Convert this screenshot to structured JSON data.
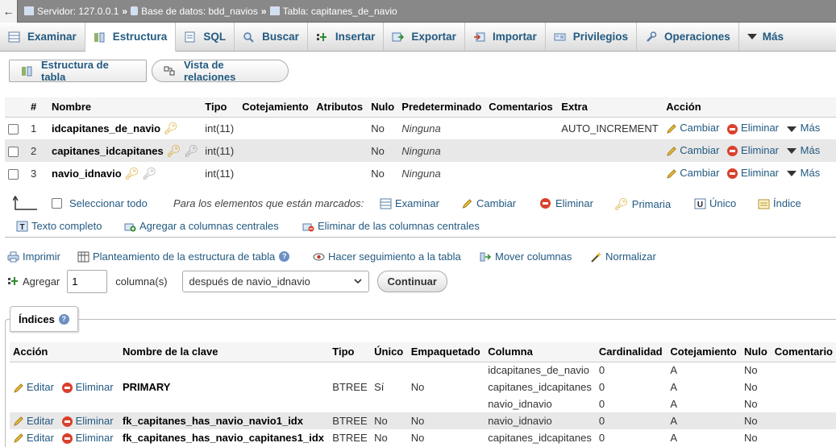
{
  "breadcrumb": {
    "back_icon": "arrow-left-icon",
    "server": "Servidor: 127.0.0.1",
    "database": "Base de datos: bdd_navios",
    "table": "Tabla: capitanes_de_navio",
    "separator": "»"
  },
  "tabs": [
    {
      "label": "Examinar",
      "icon": "browse-icon",
      "active": false
    },
    {
      "label": "Estructura",
      "icon": "structure-icon",
      "active": true
    },
    {
      "label": "SQL",
      "icon": "sql-icon",
      "active": false
    },
    {
      "label": "Buscar",
      "icon": "search-icon",
      "active": false
    },
    {
      "label": "Insertar",
      "icon": "insert-icon",
      "active": false
    },
    {
      "label": "Exportar",
      "icon": "export-icon",
      "active": false
    },
    {
      "label": "Importar",
      "icon": "import-icon",
      "active": false
    },
    {
      "label": "Privilegios",
      "icon": "privileges-icon",
      "active": false
    },
    {
      "label": "Operaciones",
      "icon": "wrench-icon",
      "active": false
    },
    {
      "label": "Más",
      "icon": "chevron-down-icon",
      "active": false
    }
  ],
  "subtabs": {
    "structure": "Estructura de tabla",
    "relations": "Vista de relaciones"
  },
  "columns_table": {
    "headers": [
      "#",
      "Nombre",
      "Tipo",
      "Cotejamiento",
      "Atributos",
      "Nulo",
      "Predeterminado",
      "Comentarios",
      "Extra",
      "Acción"
    ],
    "rows": [
      {
        "num": "1",
        "name": "idcapitanes_de_navio",
        "keys": [
          "primary"
        ],
        "type": "int(11)",
        "null": "No",
        "default": "Ninguna",
        "extra": "AUTO_INCREMENT"
      },
      {
        "num": "2",
        "name": "capitanes_idcapitanes",
        "keys": [
          "primary",
          "index"
        ],
        "type": "int(11)",
        "null": "No",
        "default": "Ninguna",
        "extra": ""
      },
      {
        "num": "3",
        "name": "navio_idnavio",
        "keys": [
          "primary",
          "index"
        ],
        "type": "int(11)",
        "null": "No",
        "default": "Ninguna",
        "extra": ""
      }
    ],
    "actions": {
      "change": "Cambiar",
      "drop": "Eliminar",
      "more": "Más"
    }
  },
  "bulk": {
    "select_all": "Seleccionar todo",
    "with_selected": "Para los elementos que están marcados:",
    "browse": "Examinar",
    "change": "Cambiar",
    "drop": "Eliminar",
    "primary": "Primaria",
    "unique": "Único",
    "index": "Índice",
    "fulltext": "Texto completo",
    "add_central": "Agregar a columnas centrales",
    "remove_central": "Eliminar de las columnas centrales"
  },
  "tools": {
    "print": "Imprimir",
    "propose": "Planteamiento de la estructura de tabla",
    "track": "Hacer seguimiento a la tabla",
    "move": "Mover columnas",
    "normalize": "Normalizar"
  },
  "add_columns": {
    "label": "Agregar",
    "value": "1",
    "unit": "columna(s)",
    "position": "después de navio_idnavio",
    "button": "Continuar"
  },
  "indexes": {
    "legend": "Índices",
    "headers": [
      "Acción",
      "Nombre de la clave",
      "Tipo",
      "Único",
      "Empaquetado",
      "Columna",
      "Cardinalidad",
      "Cotejamiento",
      "Nulo",
      "Comentario"
    ],
    "actions": {
      "edit": "Editar",
      "drop": "Eliminar"
    },
    "rows": [
      {
        "key": "PRIMARY",
        "type": "BTREE",
        "unique": "Sí",
        "packed": "No",
        "parts": [
          {
            "column": "idcapitanes_de_navio",
            "cardinality": "0",
            "collation": "A",
            "null": "No"
          },
          {
            "column": "capitanes_idcapitanes",
            "cardinality": "0",
            "collation": "A",
            "null": "No"
          },
          {
            "column": "navio_idnavio",
            "cardinality": "0",
            "collation": "A",
            "null": "No"
          }
        ]
      },
      {
        "key": "fk_capitanes_has_navio_navio1_idx",
        "type": "BTREE",
        "unique": "No",
        "packed": "No",
        "parts": [
          {
            "column": "navio_idnavio",
            "cardinality": "0",
            "collation": "A",
            "null": "No"
          }
        ]
      },
      {
        "key": "fk_capitanes_has_navio_capitanes1_idx",
        "type": "BTREE",
        "unique": "No",
        "packed": "No",
        "parts": [
          {
            "column": "capitanes_idcapitanes",
            "cardinality": "0",
            "collation": "A",
            "null": "No"
          }
        ]
      }
    ]
  }
}
